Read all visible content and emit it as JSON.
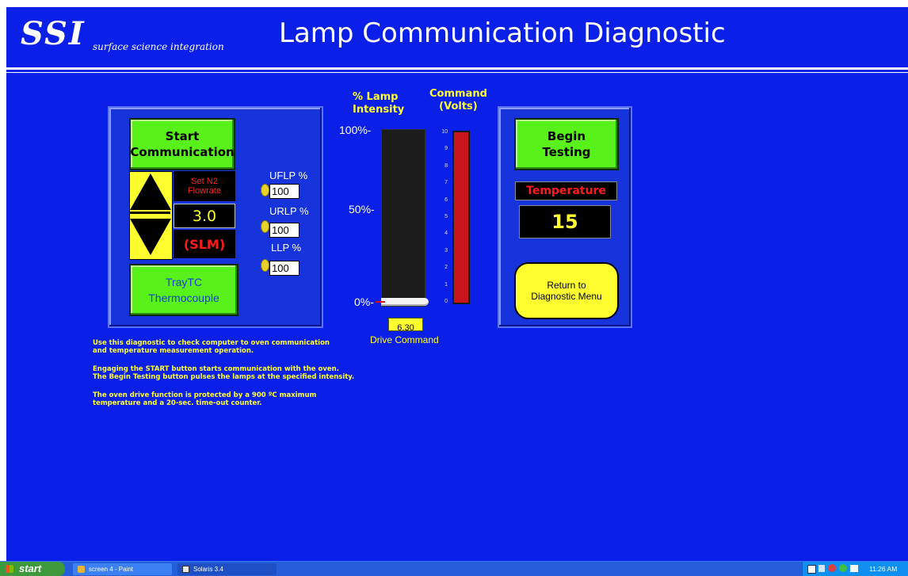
{
  "header": {
    "logo_mark": "SSI",
    "logo_text": "surface science integration",
    "title": "Lamp Communication Diagnostic"
  },
  "left_panel": {
    "start_button": "Start\nCommunication",
    "flow_label": "Set N2\nFlowrate",
    "flow_value": "3.0",
    "flow_unit": "(SLM)",
    "tc_button": "TrayTC\nThermocouple",
    "uflp_label": "UFLP %",
    "uflp_value": "100",
    "urlp_label": "URLP %",
    "urlp_value": "100",
    "llp_label": "LLP %",
    "llp_value": "100"
  },
  "gauges": {
    "intensity_title": "% Lamp\nIntensity",
    "command_title": "Command\n(Volts)",
    "intensity_ticks": [
      "100%-",
      "50%-",
      "0%-"
    ],
    "intensity_percent": 0,
    "volt_ticks": [
      "10",
      "9",
      "8",
      "7",
      "6",
      "5",
      "4",
      "3",
      "2",
      "1",
      "0"
    ],
    "command_volts": 10,
    "drive_value": "6.30",
    "drive_label": "Drive Command"
  },
  "right_panel": {
    "begin_button": "Begin\nTesting",
    "temp_label": "Temperature",
    "temp_value": "15",
    "return_button": "Return to\nDiagnostic Menu"
  },
  "notes": [
    "Use this diagnostic to check computer to oven communication\nand temperature measurement operation.",
    "Engaging the START button starts communication with the oven.\nThe Begin Testing button pulses the lamps at the specified intensity.",
    "The oven drive function is protected by a 900 ºC maximum\ntemperature and a 20-sec. time-out counter."
  ],
  "taskbar": {
    "start_label": "start",
    "task1": "screen 4 - Paint",
    "task2": "Solaris 3.4",
    "clock": "11:26 AM"
  },
  "colors": {
    "background": "#0a1fe8",
    "button_green": "#58f21a",
    "accent_yellow": "#ffff30",
    "alarm_red": "#ff1a1a"
  }
}
